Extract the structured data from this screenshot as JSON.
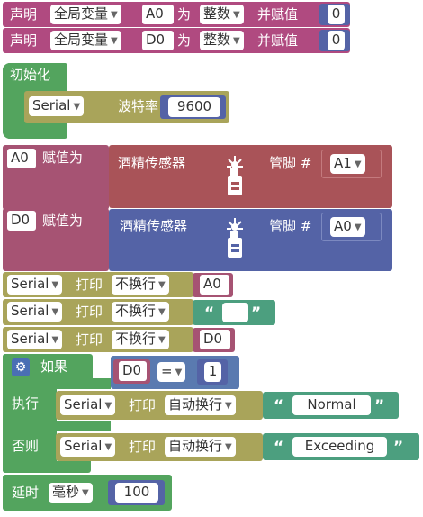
{
  "blocks": {
    "declare_a0": {
      "kw": "声明",
      "scope": "全局变量",
      "var": "A0",
      "as": "为",
      "type": "整数",
      "assign": "并赋值",
      "value": "0"
    },
    "declare_d0": {
      "kw": "声明",
      "scope": "全局变量",
      "var": "D0",
      "as": "为",
      "type": "整数",
      "assign": "并赋值",
      "value": "0"
    },
    "setup": {
      "label": "初始化",
      "serial": "Serial",
      "baud_label": "波特率",
      "baud": "9600"
    },
    "assign_a0": {
      "var": "A0",
      "label": "赋值为",
      "sensor": "酒精传感器",
      "pin_label": "管脚 #",
      "pin": "A1"
    },
    "assign_d0": {
      "var": "D0",
      "label": "赋值为",
      "sensor": "酒精传感器",
      "pin_label": "管脚 #",
      "pin": "A0"
    },
    "print1": {
      "serial": "Serial",
      "label": "打印",
      "mode": "不换行",
      "value": "A0"
    },
    "print2": {
      "serial": "Serial",
      "label": "打印",
      "mode": "不换行",
      "q_open": "“",
      "q_close": "”",
      "value": ""
    },
    "print3": {
      "serial": "Serial",
      "label": "打印",
      "mode": "不换行",
      "value": "D0"
    },
    "if": {
      "label": "如果",
      "var": "D0",
      "op": "=",
      "num": "1",
      "then": "执行",
      "else": "否则"
    },
    "then_print": {
      "serial": "Serial",
      "label": "打印",
      "mode": "自动换行",
      "q_open": "“",
      "text": "Normal",
      "q_close": "”"
    },
    "else_print": {
      "serial": "Serial",
      "label": "打印",
      "mode": "自动换行",
      "q_open": "“",
      "text": "Exceeding",
      "q_close": "”"
    },
    "delay": {
      "label": "延时",
      "unit": "毫秒",
      "value": "100"
    }
  },
  "icons": {
    "sensor": "alcohol-sensor-icon",
    "gear": "gear-icon",
    "arrow": "dropdown-arrow-icon"
  },
  "colors": {
    "declare": "#b04a80",
    "setup": "#53a45e",
    "serial": "#a9a45a",
    "var": "#a65373",
    "sensor": "#a95358",
    "sensor2": "#5463a6",
    "text": "#4c9f7f",
    "logic": "#5a7ab0",
    "control": "#53a45e"
  }
}
